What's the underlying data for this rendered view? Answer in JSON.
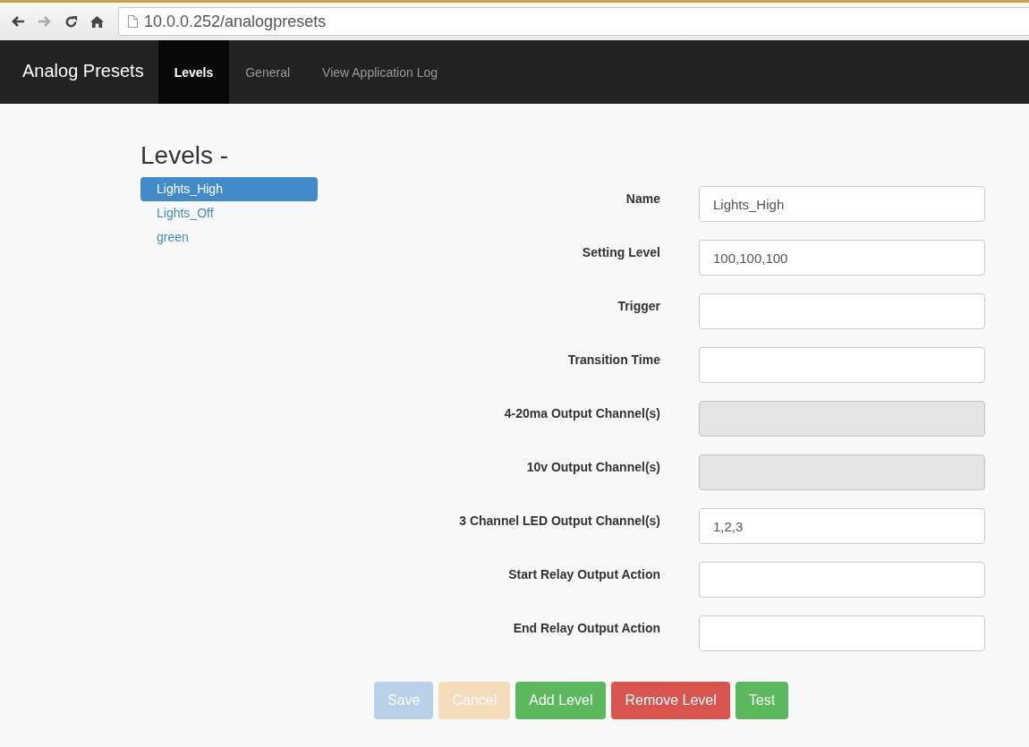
{
  "browser": {
    "url": "10.0.0.252/analogpresets"
  },
  "navbar": {
    "brand": "Analog Presets",
    "tabs": [
      {
        "label": "Levels",
        "selected": true
      },
      {
        "label": "General",
        "selected": false
      },
      {
        "label": "View Application Log",
        "selected": false
      }
    ]
  },
  "levels": {
    "title": "Levels -",
    "items": [
      {
        "label": "Lights_High",
        "selected": true
      },
      {
        "label": "Lights_Off",
        "selected": false
      },
      {
        "label": "green",
        "selected": false
      }
    ]
  },
  "form": {
    "fields": [
      {
        "label": "Name",
        "value": "Lights_High",
        "disabled": false
      },
      {
        "label": "Setting Level",
        "value": "100,100,100",
        "disabled": false
      },
      {
        "label": "Trigger",
        "disabled": false
      },
      {
        "label": "Transition Time",
        "disabled": false
      },
      {
        "label": "4-20ma Output Channel(s)",
        "disabled": true
      },
      {
        "label": "10v Output Channel(s)",
        "disabled": true
      },
      {
        "label": "3 Channel LED Output Channel(s)",
        "value": "1,2,3",
        "disabled": false
      },
      {
        "label": "Start Relay Output Action",
        "disabled": false
      },
      {
        "label": "End Relay Output Action",
        "disabled": false
      }
    ]
  },
  "buttons": [
    {
      "label": "Save",
      "kind": "primary",
      "disabled": true
    },
    {
      "label": "Cancel",
      "kind": "warning",
      "disabled": true
    },
    {
      "label": "Add Level",
      "kind": "success",
      "disabled": false
    },
    {
      "label": "Remove Level",
      "kind": "danger",
      "disabled": false
    },
    {
      "label": "Test",
      "kind": "success",
      "disabled": false
    }
  ]
}
